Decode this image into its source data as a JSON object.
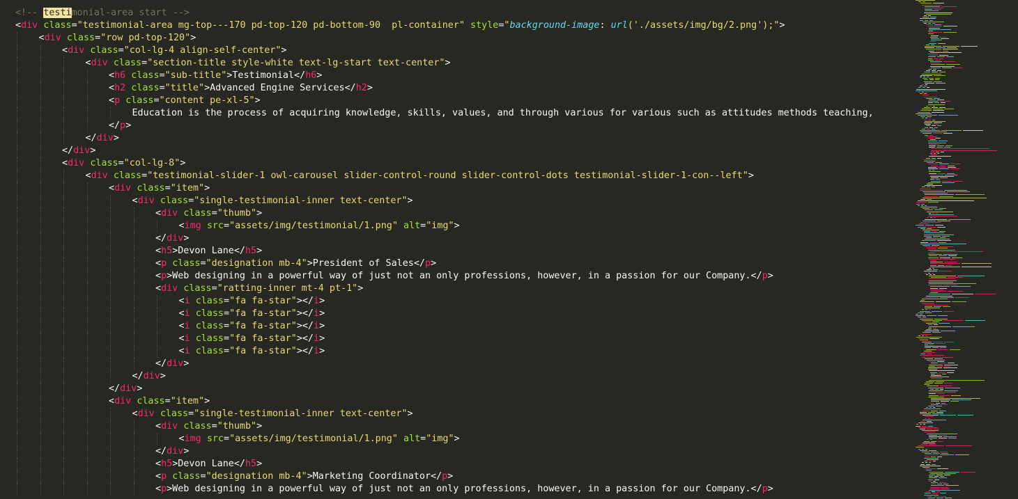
{
  "editor": {
    "lines": [
      {
        "indent": 0,
        "tokens": [
          [
            "cm",
            "<!-- "
          ],
          [
            "hl",
            "testi"
          ],
          [
            "cm",
            "monial-area start -->"
          ]
        ]
      },
      {
        "indent": 0,
        "tokens": [
          [
            "pl",
            "<"
          ],
          [
            "tag",
            "div"
          ],
          [
            "pl",
            " "
          ],
          [
            "attr",
            "class"
          ],
          [
            "pl",
            "="
          ],
          [
            "str",
            "\"testimonial-area mg-top---170 pd-top-120 pd-bottom-90  pl-container\""
          ],
          [
            "pl",
            " "
          ],
          [
            "attr",
            "style"
          ],
          [
            "pl",
            "="
          ],
          [
            "str",
            "\""
          ],
          [
            "prop",
            "background-image"
          ],
          [
            "pl",
            ": "
          ],
          [
            "prop",
            "url"
          ],
          [
            "str",
            "('./assets/img/bg/2.png');\""
          ],
          [
            "pl",
            ">"
          ]
        ]
      },
      {
        "indent": 1,
        "tokens": [
          [
            "pl",
            "<"
          ],
          [
            "tag",
            "div"
          ],
          [
            "pl",
            " "
          ],
          [
            "attr",
            "class"
          ],
          [
            "pl",
            "="
          ],
          [
            "str",
            "\"row pd-top-120\""
          ],
          [
            "pl",
            ">"
          ]
        ]
      },
      {
        "indent": 2,
        "tokens": [
          [
            "pl",
            "<"
          ],
          [
            "tag",
            "div"
          ],
          [
            "pl",
            " "
          ],
          [
            "attr",
            "class"
          ],
          [
            "pl",
            "="
          ],
          [
            "str",
            "\"col-lg-4 align-self-center\""
          ],
          [
            "pl",
            ">"
          ]
        ]
      },
      {
        "indent": 3,
        "tokens": [
          [
            "pl",
            "<"
          ],
          [
            "tag",
            "div"
          ],
          [
            "pl",
            " "
          ],
          [
            "attr",
            "class"
          ],
          [
            "pl",
            "="
          ],
          [
            "str",
            "\"section-title style-white text-lg-start text-center\""
          ],
          [
            "pl",
            ">"
          ]
        ]
      },
      {
        "indent": 4,
        "tokens": [
          [
            "pl",
            "<"
          ],
          [
            "tag",
            "h6"
          ],
          [
            "pl",
            " "
          ],
          [
            "attr",
            "class"
          ],
          [
            "pl",
            "="
          ],
          [
            "str",
            "\"sub-title\""
          ],
          [
            "pl",
            ">Testimonial</"
          ],
          [
            "tag",
            "h6"
          ],
          [
            "pl",
            ">"
          ]
        ]
      },
      {
        "indent": 4,
        "tokens": [
          [
            "pl",
            "<"
          ],
          [
            "tag",
            "h2"
          ],
          [
            "pl",
            " "
          ],
          [
            "attr",
            "class"
          ],
          [
            "pl",
            "="
          ],
          [
            "str",
            "\"title\""
          ],
          [
            "pl",
            ">Advanced Engine Services</"
          ],
          [
            "tag",
            "h2"
          ],
          [
            "pl",
            ">"
          ]
        ]
      },
      {
        "indent": 4,
        "tokens": [
          [
            "pl",
            "<"
          ],
          [
            "tag",
            "p"
          ],
          [
            "pl",
            " "
          ],
          [
            "attr",
            "class"
          ],
          [
            "pl",
            "="
          ],
          [
            "str",
            "\"content pe-xl-5\""
          ],
          [
            "pl",
            ">"
          ]
        ]
      },
      {
        "indent": 5,
        "tokens": [
          [
            "pl",
            "Education is the process of acquiring knowledge, skills, values, and through various for various such as attitudes methods teaching,"
          ]
        ]
      },
      {
        "indent": 4,
        "tokens": [
          [
            "pl",
            "</"
          ],
          [
            "tag",
            "p"
          ],
          [
            "pl",
            ">"
          ]
        ]
      },
      {
        "indent": 3,
        "tokens": [
          [
            "pl",
            "</"
          ],
          [
            "tag",
            "div"
          ],
          [
            "pl",
            ">"
          ]
        ]
      },
      {
        "indent": 2,
        "tokens": [
          [
            "pl",
            "</"
          ],
          [
            "tag",
            "div"
          ],
          [
            "pl",
            ">"
          ]
        ]
      },
      {
        "indent": 2,
        "tokens": [
          [
            "pl",
            "<"
          ],
          [
            "tag",
            "div"
          ],
          [
            "pl",
            " "
          ],
          [
            "attr",
            "class"
          ],
          [
            "pl",
            "="
          ],
          [
            "str",
            "\"col-lg-8\""
          ],
          [
            "pl",
            ">"
          ]
        ]
      },
      {
        "indent": 3,
        "tokens": [
          [
            "pl",
            "<"
          ],
          [
            "tag",
            "div"
          ],
          [
            "pl",
            " "
          ],
          [
            "attr",
            "class"
          ],
          [
            "pl",
            "="
          ],
          [
            "str",
            "\"testimonial-slider-1 owl-carousel slider-control-round slider-control-dots testimonial-slider-1-con--left\""
          ],
          [
            "pl",
            ">"
          ]
        ]
      },
      {
        "indent": 4,
        "tokens": [
          [
            "pl",
            "<"
          ],
          [
            "tag",
            "div"
          ],
          [
            "pl",
            " "
          ],
          [
            "attr",
            "class"
          ],
          [
            "pl",
            "="
          ],
          [
            "str",
            "\"item\""
          ],
          [
            "pl",
            ">"
          ]
        ]
      },
      {
        "indent": 5,
        "tokens": [
          [
            "pl",
            "<"
          ],
          [
            "tag",
            "div"
          ],
          [
            "pl",
            " "
          ],
          [
            "attr",
            "class"
          ],
          [
            "pl",
            "="
          ],
          [
            "str",
            "\"single-testimonial-inner text-center\""
          ],
          [
            "pl",
            ">"
          ]
        ]
      },
      {
        "indent": 6,
        "tokens": [
          [
            "pl",
            "<"
          ],
          [
            "tag",
            "div"
          ],
          [
            "pl",
            " "
          ],
          [
            "attr",
            "class"
          ],
          [
            "pl",
            "="
          ],
          [
            "str",
            "\"thumb\""
          ],
          [
            "pl",
            ">"
          ]
        ]
      },
      {
        "indent": 7,
        "tokens": [
          [
            "pl",
            "<"
          ],
          [
            "tag",
            "img"
          ],
          [
            "pl",
            " "
          ],
          [
            "attr",
            "src"
          ],
          [
            "pl",
            "="
          ],
          [
            "str",
            "\"assets/img/testimonial/1.png\""
          ],
          [
            "pl",
            " "
          ],
          [
            "attr",
            "alt"
          ],
          [
            "pl",
            "="
          ],
          [
            "str",
            "\"img\""
          ],
          [
            "pl",
            ">"
          ]
        ]
      },
      {
        "indent": 6,
        "tokens": [
          [
            "pl",
            "</"
          ],
          [
            "tag",
            "div"
          ],
          [
            "pl",
            ">"
          ]
        ]
      },
      {
        "indent": 6,
        "tokens": [
          [
            "pl",
            "<"
          ],
          [
            "tag",
            "h5"
          ],
          [
            "pl",
            ">Devon Lane</"
          ],
          [
            "tag",
            "h5"
          ],
          [
            "pl",
            ">"
          ]
        ]
      },
      {
        "indent": 6,
        "tokens": [
          [
            "pl",
            "<"
          ],
          [
            "tag",
            "p"
          ],
          [
            "pl",
            " "
          ],
          [
            "attr",
            "class"
          ],
          [
            "pl",
            "="
          ],
          [
            "str",
            "\"designation mb-4\""
          ],
          [
            "pl",
            ">President of Sales</"
          ],
          [
            "tag",
            "p"
          ],
          [
            "pl",
            ">"
          ]
        ]
      },
      {
        "indent": 6,
        "tokens": [
          [
            "pl",
            "<"
          ],
          [
            "tag",
            "p"
          ],
          [
            "pl",
            ">Web designing in a powerful way of just not an only professions, however, in a passion for our Company.</"
          ],
          [
            "tag",
            "p"
          ],
          [
            "pl",
            ">"
          ]
        ]
      },
      {
        "indent": 6,
        "tokens": [
          [
            "pl",
            "<"
          ],
          [
            "tag",
            "div"
          ],
          [
            "pl",
            " "
          ],
          [
            "attr",
            "class"
          ],
          [
            "pl",
            "="
          ],
          [
            "str",
            "\"ratting-inner mt-4 pt-1\""
          ],
          [
            "pl",
            ">"
          ]
        ]
      },
      {
        "indent": 7,
        "tokens": [
          [
            "pl",
            "<"
          ],
          [
            "tag",
            "i"
          ],
          [
            "pl",
            " "
          ],
          [
            "attr",
            "class"
          ],
          [
            "pl",
            "="
          ],
          [
            "str",
            "\"fa fa-star\""
          ],
          [
            "pl",
            "></"
          ],
          [
            "tag",
            "i"
          ],
          [
            "pl",
            ">"
          ]
        ]
      },
      {
        "indent": 7,
        "tokens": [
          [
            "pl",
            "<"
          ],
          [
            "tag",
            "i"
          ],
          [
            "pl",
            " "
          ],
          [
            "attr",
            "class"
          ],
          [
            "pl",
            "="
          ],
          [
            "str",
            "\"fa fa-star\""
          ],
          [
            "pl",
            "></"
          ],
          [
            "tag",
            "i"
          ],
          [
            "pl",
            ">"
          ]
        ]
      },
      {
        "indent": 7,
        "tokens": [
          [
            "pl",
            "<"
          ],
          [
            "tag",
            "i"
          ],
          [
            "pl",
            " "
          ],
          [
            "attr",
            "class"
          ],
          [
            "pl",
            "="
          ],
          [
            "str",
            "\"fa fa-star\""
          ],
          [
            "pl",
            "></"
          ],
          [
            "tag",
            "i"
          ],
          [
            "pl",
            ">"
          ]
        ]
      },
      {
        "indent": 7,
        "tokens": [
          [
            "pl",
            "<"
          ],
          [
            "tag",
            "i"
          ],
          [
            "pl",
            " "
          ],
          [
            "attr",
            "class"
          ],
          [
            "pl",
            "="
          ],
          [
            "str",
            "\"fa fa-star\""
          ],
          [
            "pl",
            "></"
          ],
          [
            "tag",
            "i"
          ],
          [
            "pl",
            ">"
          ]
        ]
      },
      {
        "indent": 7,
        "tokens": [
          [
            "pl",
            "<"
          ],
          [
            "tag",
            "i"
          ],
          [
            "pl",
            " "
          ],
          [
            "attr",
            "class"
          ],
          [
            "pl",
            "="
          ],
          [
            "str",
            "\"fa fa-star\""
          ],
          [
            "pl",
            "></"
          ],
          [
            "tag",
            "i"
          ],
          [
            "pl",
            ">"
          ]
        ]
      },
      {
        "indent": 6,
        "tokens": [
          [
            "pl",
            "</"
          ],
          [
            "tag",
            "div"
          ],
          [
            "pl",
            ">"
          ]
        ]
      },
      {
        "indent": 5,
        "tokens": [
          [
            "pl",
            "</"
          ],
          [
            "tag",
            "div"
          ],
          [
            "pl",
            ">"
          ]
        ]
      },
      {
        "indent": 4,
        "tokens": [
          [
            "pl",
            "</"
          ],
          [
            "tag",
            "div"
          ],
          [
            "pl",
            ">"
          ]
        ]
      },
      {
        "indent": 4,
        "tokens": [
          [
            "pl",
            "<"
          ],
          [
            "tag",
            "div"
          ],
          [
            "pl",
            " "
          ],
          [
            "attr",
            "class"
          ],
          [
            "pl",
            "="
          ],
          [
            "str",
            "\"item\""
          ],
          [
            "pl",
            ">"
          ]
        ]
      },
      {
        "indent": 5,
        "tokens": [
          [
            "pl",
            "<"
          ],
          [
            "tag",
            "div"
          ],
          [
            "pl",
            " "
          ],
          [
            "attr",
            "class"
          ],
          [
            "pl",
            "="
          ],
          [
            "str",
            "\"single-testimonial-inner text-center\""
          ],
          [
            "pl",
            ">"
          ]
        ]
      },
      {
        "indent": 6,
        "tokens": [
          [
            "pl",
            "<"
          ],
          [
            "tag",
            "div"
          ],
          [
            "pl",
            " "
          ],
          [
            "attr",
            "class"
          ],
          [
            "pl",
            "="
          ],
          [
            "str",
            "\"thumb\""
          ],
          [
            "pl",
            ">"
          ]
        ]
      },
      {
        "indent": 7,
        "tokens": [
          [
            "pl",
            "<"
          ],
          [
            "tag",
            "img"
          ],
          [
            "pl",
            " "
          ],
          [
            "attr",
            "src"
          ],
          [
            "pl",
            "="
          ],
          [
            "str",
            "\"assets/img/testimonial/1.png\""
          ],
          [
            "pl",
            " "
          ],
          [
            "attr",
            "alt"
          ],
          [
            "pl",
            "="
          ],
          [
            "str",
            "\"img\""
          ],
          [
            "pl",
            ">"
          ]
        ]
      },
      {
        "indent": 6,
        "tokens": [
          [
            "pl",
            "</"
          ],
          [
            "tag",
            "div"
          ],
          [
            "pl",
            ">"
          ]
        ]
      },
      {
        "indent": 6,
        "tokens": [
          [
            "pl",
            "<"
          ],
          [
            "tag",
            "h5"
          ],
          [
            "pl",
            ">Devon Lane</"
          ],
          [
            "tag",
            "h5"
          ],
          [
            "pl",
            ">"
          ]
        ]
      },
      {
        "indent": 6,
        "tokens": [
          [
            "pl",
            "<"
          ],
          [
            "tag",
            "p"
          ],
          [
            "pl",
            " "
          ],
          [
            "attr",
            "class"
          ],
          [
            "pl",
            "="
          ],
          [
            "str",
            "\"designation mb-4\""
          ],
          [
            "pl",
            ">Marketing Coordinator</"
          ],
          [
            "tag",
            "p"
          ],
          [
            "pl",
            ">"
          ]
        ]
      },
      {
        "indent": 6,
        "tokens": [
          [
            "pl",
            "<"
          ],
          [
            "tag",
            "p"
          ],
          [
            "pl",
            ">Web designing in a powerful way of just not an only professions, however, in a passion for our Company.</"
          ],
          [
            "tag",
            "p"
          ],
          [
            "pl",
            ">"
          ]
        ]
      }
    ]
  },
  "theme": {
    "background": "#272822",
    "foreground": "#f8f8f2",
    "tag": "#f92672",
    "attribute": "#a6e22e",
    "string": "#e6db74",
    "property": "#66d9ef",
    "comment": "#75715e",
    "highlight": "#f4e4a4"
  }
}
